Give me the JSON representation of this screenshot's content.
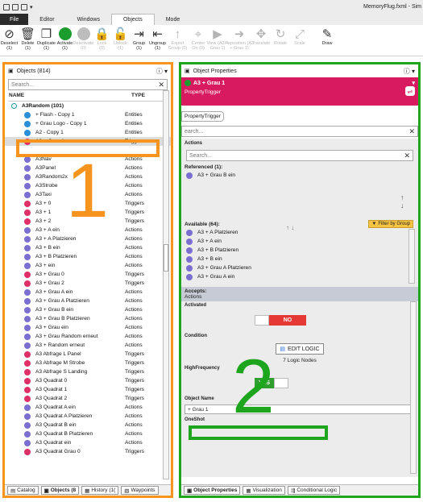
{
  "window": {
    "title": "MemoryFlug.fxml - Sim"
  },
  "menu": {
    "items": [
      "File",
      "Editor",
      "Windows",
      "Objects",
      "Mode"
    ],
    "active": "Objects"
  },
  "ribbon": {
    "buttons": [
      {
        "label": "Deselect",
        "count": "(1)",
        "icon": "deselect-icon",
        "enabled": true
      },
      {
        "label": "Delete",
        "count": "(1)",
        "icon": "trash-icon",
        "enabled": true
      },
      {
        "label": "Duplicate",
        "count": "(1)",
        "icon": "duplicate-icon",
        "enabled": true
      },
      {
        "label": "Activate",
        "count": "(1)",
        "icon": "activate-icon",
        "enabled": true
      },
      {
        "label": "Deactivate",
        "count": "(0)",
        "icon": "deactivate-icon",
        "enabled": false
      },
      {
        "label": "Lock",
        "count": "(0)",
        "icon": "lock-icon",
        "enabled": false
      },
      {
        "label": "Unlock",
        "count": "(1)",
        "icon": "unlock-icon",
        "enabled": false
      },
      {
        "label": "Group",
        "count": "(1)",
        "icon": "group-icon",
        "enabled": true
      },
      {
        "label": "Ungroup",
        "count": "(1)",
        "icon": "ungroup-icon",
        "enabled": true
      },
      {
        "label": "Export",
        "count": "Group (0)",
        "icon": "export-icon",
        "enabled": false
      },
      {
        "label": "Center",
        "count": "On (0)",
        "icon": "center-icon",
        "enabled": false
      },
      {
        "label": "View (A3 +",
        "count": "Grau 1)",
        "icon": "view-icon",
        "enabled": false
      },
      {
        "label": "Reposition (A3",
        "count": "+ Grau 1)",
        "icon": "reposition-icon",
        "enabled": false
      },
      {
        "label": "Translate",
        "count": "",
        "icon": "translate-icon",
        "enabled": false
      },
      {
        "label": "Rotate",
        "count": "",
        "icon": "rotate-icon",
        "enabled": false
      },
      {
        "label": "Scale",
        "count": "",
        "icon": "scale-icon",
        "enabled": false
      },
      {
        "label": "Draw",
        "count": "",
        "icon": "draw-icon",
        "enabled": true
      }
    ]
  },
  "objects_panel": {
    "title": "Objects (814)",
    "search_placeholder": "Search...",
    "col_name": "NAME",
    "col_type": "TYPE",
    "group": "A3Random (101)",
    "rows": [
      {
        "name": "+ Flash - Copy 1",
        "type": "Entities",
        "kind": "ent"
      },
      {
        "name": "+ Grau Logo - Copy 1",
        "type": "Entities",
        "kind": "ent"
      },
      {
        "name": "A2 - Copy 1",
        "type": "Entities",
        "kind": "ent"
      },
      {
        "name": "A3 + Grau 1",
        "type": "Triggers",
        "kind": "trg",
        "selected": true
      },
      {
        "name": "",
        "type": "",
        "kind": "blank"
      },
      {
        "name": "A3Nav",
        "type": "Actions",
        "kind": "act"
      },
      {
        "name": "A3Panel",
        "type": "Actions",
        "kind": "act"
      },
      {
        "name": "A3Random2x",
        "type": "Actions",
        "kind": "act"
      },
      {
        "name": "A3Strobe",
        "type": "Actions",
        "kind": "act"
      },
      {
        "name": "A3Taxi",
        "type": "Actions",
        "kind": "act"
      },
      {
        "name": "A3 + 0",
        "type": "Triggers",
        "kind": "trg"
      },
      {
        "name": "A3 + 1",
        "type": "Triggers",
        "kind": "trg"
      },
      {
        "name": "A3 + 2",
        "type": "Triggers",
        "kind": "trg"
      },
      {
        "name": "A3 + A ein",
        "type": "Actions",
        "kind": "act"
      },
      {
        "name": "A3 + A Platzieren",
        "type": "Actions",
        "kind": "act"
      },
      {
        "name": "A3 + B ein",
        "type": "Actions",
        "kind": "act"
      },
      {
        "name": "A3 + B Platzieren",
        "type": "Actions",
        "kind": "act"
      },
      {
        "name": "A3 + ein",
        "type": "Actions",
        "kind": "act"
      },
      {
        "name": "A3 + Grau 0",
        "type": "Triggers",
        "kind": "trg"
      },
      {
        "name": "A3 + Grau 2",
        "type": "Triggers",
        "kind": "trg"
      },
      {
        "name": "A3 + Grau A ein",
        "type": "Actions",
        "kind": "act"
      },
      {
        "name": "A3 + Grau A Platzieren",
        "type": "Actions",
        "kind": "act"
      },
      {
        "name": "A3 + Grau B ein",
        "type": "Actions",
        "kind": "act"
      },
      {
        "name": "A3 + Grau B Platzieren",
        "type": "Actions",
        "kind": "act"
      },
      {
        "name": "A3 + Grau ein",
        "type": "Actions",
        "kind": "act"
      },
      {
        "name": "A3 + Grau Random erneut",
        "type": "Actions",
        "kind": "act"
      },
      {
        "name": "A3 + Random erneut",
        "type": "Actions",
        "kind": "act"
      },
      {
        "name": "A3 Abfrage L Panel",
        "type": "Triggers",
        "kind": "trg"
      },
      {
        "name": "A3 Abfrage M Strobe",
        "type": "Triggers",
        "kind": "trg"
      },
      {
        "name": "A3 Abfrage S Landing",
        "type": "Triggers",
        "kind": "trg"
      },
      {
        "name": "A3 Quadrat 0",
        "type": "Triggers",
        "kind": "trg"
      },
      {
        "name": "A3 Quadrat 1",
        "type": "Triggers",
        "kind": "trg"
      },
      {
        "name": "A3 Quadrat 2",
        "type": "Triggers",
        "kind": "trg"
      },
      {
        "name": "A3 Quadrat A ein",
        "type": "Actions",
        "kind": "act"
      },
      {
        "name": "A3 Quadrat A Platzieren",
        "type": "Actions",
        "kind": "act"
      },
      {
        "name": "A3 Quadrat B ein",
        "type": "Actions",
        "kind": "act"
      },
      {
        "name": "A3 Quadrat B Platzieren",
        "type": "Actions",
        "kind": "act"
      },
      {
        "name": "A3 Quadrat ein",
        "type": "Actions",
        "kind": "act"
      },
      {
        "name": "A3 Quadrat Grau 0",
        "type": "Triggers",
        "kind": "trg"
      }
    ],
    "bottom_tabs": [
      "Catalog",
      "Objects (8",
      "History (1(",
      "Waypoints"
    ]
  },
  "props_panel": {
    "title": "Object Properties",
    "obj_name": "A3 + Grau 1",
    "obj_type": "PropertyTrigger",
    "crumb": "PropertyTrigger",
    "search_placeholder": "earch...",
    "actions_label": "Actions",
    "inner_search_placeholder": "Search...",
    "referenced_label": "Referenced (1):",
    "referenced_items": [
      "A3 + Grau B ein"
    ],
    "available_label": "Available (64):",
    "filter_label": "Filter by Group",
    "available_items": [
      "A3 + A Platzieren",
      "A3 + A ein",
      "A3 + B Platzieren",
      "A3 + B ein",
      "A3 + Grau A Platzieren",
      "A3 + Grau A ein"
    ],
    "accepts_label": "Accepts:",
    "accepts_value": "Actions",
    "activated_label": "Activated",
    "activated_value": "NO",
    "condition_label": "Condition",
    "edit_logic_label": "EDIT LOGIC",
    "logic_nodes": "7 Logic Nodes",
    "highfreq_label": "HighFrequency",
    "highfreq_value": "YES",
    "objname_label": "Object Name",
    "objname_value": "+ Grau 1",
    "oneshot_label": "OneShot",
    "bottom_tabs": [
      "Object Properties",
      "Visualization",
      "Conditional Logic"
    ]
  },
  "annotations": {
    "one": "1",
    "two": "2"
  },
  "colors": {
    "orange": "#f7941d",
    "green": "#1ea51e",
    "pink": "#d81b60",
    "trigger": "#e03068",
    "action": "#7a6fd0",
    "entity": "#2a8ed8"
  }
}
